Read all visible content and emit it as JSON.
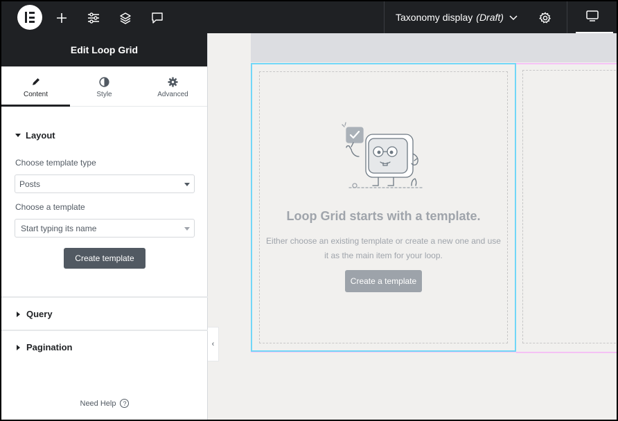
{
  "topbar": {
    "logo": "elementor-logo",
    "icons": [
      "add-icon",
      "site-settings-icon",
      "structure-icon",
      "notes-icon"
    ],
    "document_title": "Taxonomy display",
    "document_status": "(Draft)",
    "settings_icon": "gear-icon",
    "responsive_icon": "desktop-icon"
  },
  "panel": {
    "header_title": "Edit Loop Grid",
    "tabs": [
      {
        "label": "Content",
        "icon": "pencil-icon",
        "active": true
      },
      {
        "label": "Style",
        "icon": "contrast-icon",
        "active": false
      },
      {
        "label": "Advanced",
        "icon": "gear-icon",
        "active": false
      }
    ],
    "layout_section": {
      "title": "Layout",
      "template_type_label": "Choose template type",
      "template_type_value": "Posts",
      "template_label": "Choose a template",
      "template_placeholder": "Start typing its name",
      "create_button": "Create template"
    },
    "query_section": "Query",
    "pagination_section": "Pagination",
    "need_help": "Need Help"
  },
  "canvas": {
    "empty_title": "Loop Grid starts with a template.",
    "empty_desc_line1": "Either choose an existing template or create a new one and use",
    "empty_desc_line2": "it as the main item for your loop.",
    "create_button": "Create a template"
  },
  "colors": {
    "topbar_bg": "#1f2124",
    "canvas_bg": "#f1f0ee",
    "loop_item_border": "#71d7f7",
    "loop_grid_outline": "#f5c2f5",
    "muted_text": "#9fa4ab"
  }
}
